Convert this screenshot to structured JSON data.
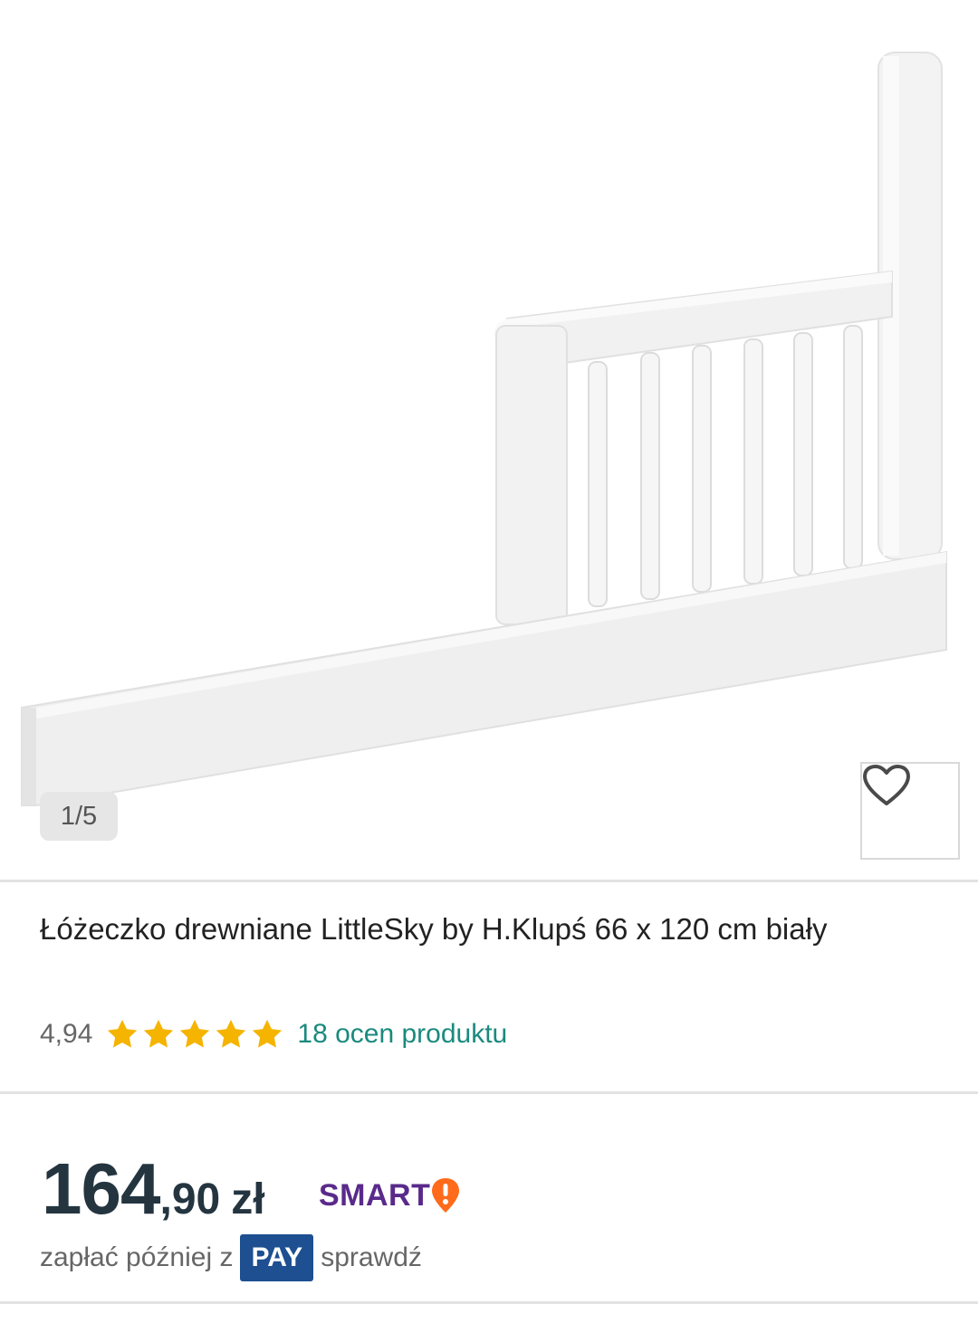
{
  "gallery": {
    "counter": "1/5",
    "favorite_icon": "heart-icon"
  },
  "product": {
    "title": "Łóżeczko drewniane LittleSky by H.Klupś 66 x 120 cm biały",
    "rating_value": "4,94",
    "rating_stars": 5,
    "rating_link": "18 ocen produktu"
  },
  "price": {
    "integer": "164",
    "decimal": ",90",
    "currency": "zł",
    "smart_label": "SMART",
    "smart_icon": "smart-exclamation-icon"
  },
  "paylater": {
    "prefix": "zapłać później z",
    "badge": "PAY",
    "suffix": "sprawdź"
  },
  "colors": {
    "star": "#f5b400",
    "link": "#1a8a7e",
    "smart": "#5a2a8b",
    "smart_accent": "#ff6b1a",
    "pay_badge": "#1d4f91"
  }
}
